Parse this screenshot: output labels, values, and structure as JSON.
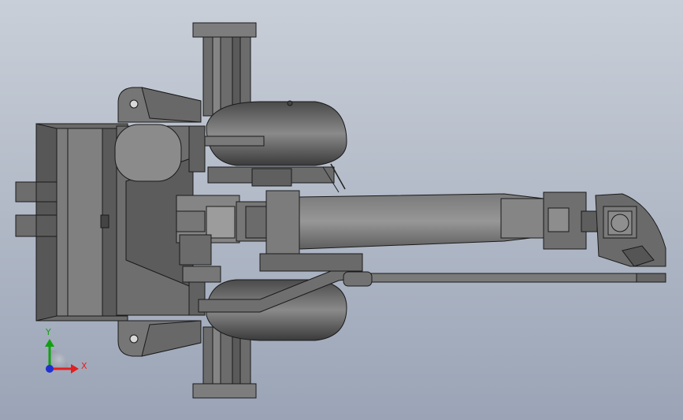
{
  "viewport": {
    "background_top": "#c9cfd8",
    "background_bottom": "#9aa4b6",
    "model_colors": {
      "light": "#8a8a8a",
      "mid": "#6f6f6f",
      "dark": "#555555",
      "darker": "#3e3e3e",
      "edge": "#1a1a1a"
    }
  },
  "triad": {
    "x_label": "X",
    "y_label": "Y",
    "x_color": "#e02020",
    "y_color": "#10a010",
    "z_color": "#2030d0"
  }
}
